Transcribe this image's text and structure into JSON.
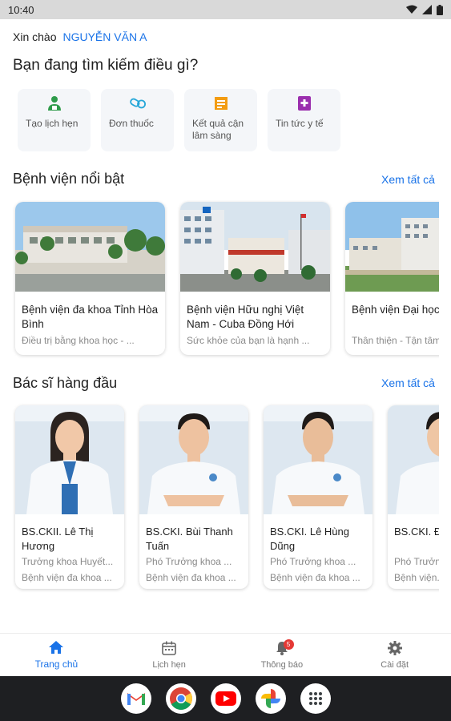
{
  "status_bar": {
    "time": "10:40"
  },
  "greeting": {
    "hello": "Xin chào",
    "user_name": "NGUYỄN VĂN A"
  },
  "question": "Bạn đang tìm kiếm điều gì?",
  "quick_actions": [
    {
      "label": "Tạo lịch hẹn",
      "icon": "user-calendar-icon",
      "color": "#2e9b4a"
    },
    {
      "label": "Đơn thuốc",
      "icon": "pill-icon",
      "color": "#26a7d8"
    },
    {
      "label": "Kết quả cận lâm sàng",
      "icon": "lab-result-icon",
      "color": "#f39c12"
    },
    {
      "label": "Tin tức y tế",
      "icon": "news-icon",
      "color": "#9b2fae"
    }
  ],
  "hospitals_section": {
    "title": "Bệnh viện nổi bật",
    "see_all": "Xem tất cả",
    "items": [
      {
        "name": "Bệnh viện đa khoa Tỉnh Hòa Bình",
        "desc": "Điều trị bằng khoa học - ..."
      },
      {
        "name": "Bệnh viện Hữu nghị Việt Nam - Cuba Đồng Hới",
        "desc": "Sức khỏe của bạn là hạnh ..."
      },
      {
        "name": "Bệnh viện Đại học Cần Thơ",
        "desc": "Thân thiện - Tận tâm"
      }
    ]
  },
  "doctors_section": {
    "title": "Bác sĩ hàng đầu",
    "see_all": "Xem tất cả",
    "items": [
      {
        "name": "BS.CKII. Lê Thị Hương",
        "position": "Trưởng khoa Huyết...",
        "hospital": "Bệnh viện đa khoa ..."
      },
      {
        "name": "BS.CKI. Bùi Thanh Tuấn",
        "position": "Phó Trưởng khoa ...",
        "hospital": "Bệnh viện đa khoa ..."
      },
      {
        "name": "BS.CKI. Lê Hùng Dũng",
        "position": "Phó Trưởng khoa ...",
        "hospital": "Bệnh viện đa khoa ..."
      },
      {
        "name": "BS.CKI. Đ... Châu",
        "position": "Phó Trưởng...",
        "hospital": "Bệnh viện..."
      }
    ]
  },
  "bottom_nav": [
    {
      "label": "Trang chủ",
      "icon": "home-icon",
      "active": true
    },
    {
      "label": "Lịch hẹn",
      "icon": "calendar-icon",
      "active": false
    },
    {
      "label": "Thông báo",
      "icon": "bell-icon",
      "active": false,
      "badge": "5"
    },
    {
      "label": "Cài đặt",
      "icon": "gear-icon",
      "active": false
    }
  ],
  "dock": [
    "gmail-icon",
    "chrome-icon",
    "youtube-icon",
    "photos-icon",
    "app-drawer-icon"
  ],
  "colors": {
    "accent": "#1a73e8",
    "badge": "#e53935"
  }
}
